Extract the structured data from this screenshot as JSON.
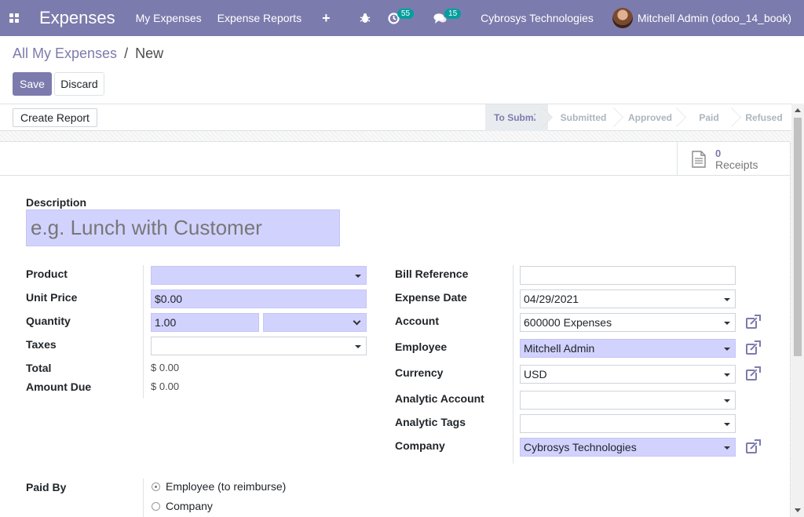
{
  "navbar": {
    "brand": "Expenses",
    "menu": [
      "My Expenses",
      "Expense Reports"
    ],
    "plus_icon": "+",
    "activity_badge": "55",
    "messages_badge": "15",
    "company": "Cybrosys Technologies",
    "user": "Mitchell Admin (odoo_14_book)"
  },
  "breadcrumb": {
    "parent": "All My Expenses",
    "separator": "/",
    "current": "New"
  },
  "buttons": {
    "save": "Save",
    "discard": "Discard",
    "create_report": "Create Report"
  },
  "stages": [
    {
      "label": "To Submit",
      "active": true
    },
    {
      "label": "Submitted",
      "active": false
    },
    {
      "label": "Approved",
      "active": false
    },
    {
      "label": "Paid",
      "active": false
    },
    {
      "label": "Refused",
      "active": false
    }
  ],
  "receipts": {
    "count": "0",
    "label": "Receipts"
  },
  "form": {
    "description_label": "Description",
    "description_placeholder": "e.g. Lunch with Customer",
    "left": {
      "product_label": "Product",
      "product_value": "",
      "unit_price_label": "Unit Price",
      "unit_price_value": "$0.00",
      "quantity_label": "Quantity",
      "quantity_value": "1.00",
      "uom_value": "",
      "taxes_label": "Taxes",
      "taxes_value": "",
      "total_label": "Total",
      "total_value": "$ 0.00",
      "amount_due_label": "Amount Due",
      "amount_due_value": "$ 0.00"
    },
    "right": {
      "bill_reference_label": "Bill Reference",
      "bill_reference_value": "",
      "expense_date_label": "Expense Date",
      "expense_date_value": "04/29/2021",
      "account_label": "Account",
      "account_value": "600000 Expenses",
      "employee_label": "Employee",
      "employee_value": "Mitchell Admin",
      "currency_label": "Currency",
      "currency_value": "USD",
      "analytic_account_label": "Analytic Account",
      "analytic_account_value": "",
      "analytic_tags_label": "Analytic Tags",
      "analytic_tags_value": "",
      "company_label": "Company",
      "company_value": "Cybrosys Technologies"
    },
    "paid_by": {
      "label": "Paid By",
      "options": [
        {
          "label": "Employee (to reimburse)",
          "checked": true
        },
        {
          "label": "Company",
          "checked": false
        }
      ]
    }
  },
  "colors": {
    "primary": "#7c7bad",
    "required_bg": "#d2d2ff",
    "badge": "#00a09d"
  },
  "icons": [
    "apps-grid-icon",
    "bug-icon",
    "activity-clock-icon",
    "chat-icon",
    "document-icon",
    "external-link-icon"
  ]
}
